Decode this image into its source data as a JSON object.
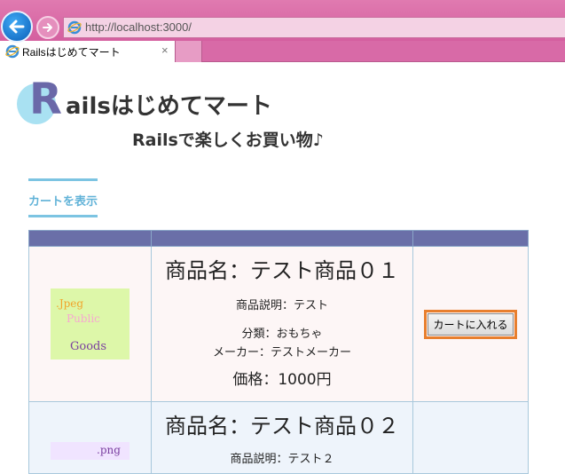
{
  "browser": {
    "url": "http://localhost:3000/",
    "tab_title": "Railsはじめてマート",
    "tab_close": "×"
  },
  "header": {
    "logo_initial": "R",
    "logo_rest": "ailsはじめてマート",
    "tagline": "Railsで楽しくお買い物♪"
  },
  "nav": {
    "cart_link": "カートを表示"
  },
  "products": [
    {
      "image_text": [
        ".Jpeg",
        "Public",
        "Goods"
      ],
      "name": "商品名：テスト商品０１",
      "description": "商品説明：テスト",
      "category": "分類：おもちゃ",
      "maker": "メーカー：テストメーカー",
      "price": "価格：1000円",
      "button": "カートに入れる"
    },
    {
      "image_text": [
        ".png"
      ],
      "name": "商品名：テスト商品０２",
      "description": "商品説明：テスト２"
    }
  ],
  "colors": {
    "chrome": "#d86aa7",
    "table_header": "#6a6fa8",
    "accent_link": "#62b3d8",
    "button_highlight": "#e87f2e"
  }
}
